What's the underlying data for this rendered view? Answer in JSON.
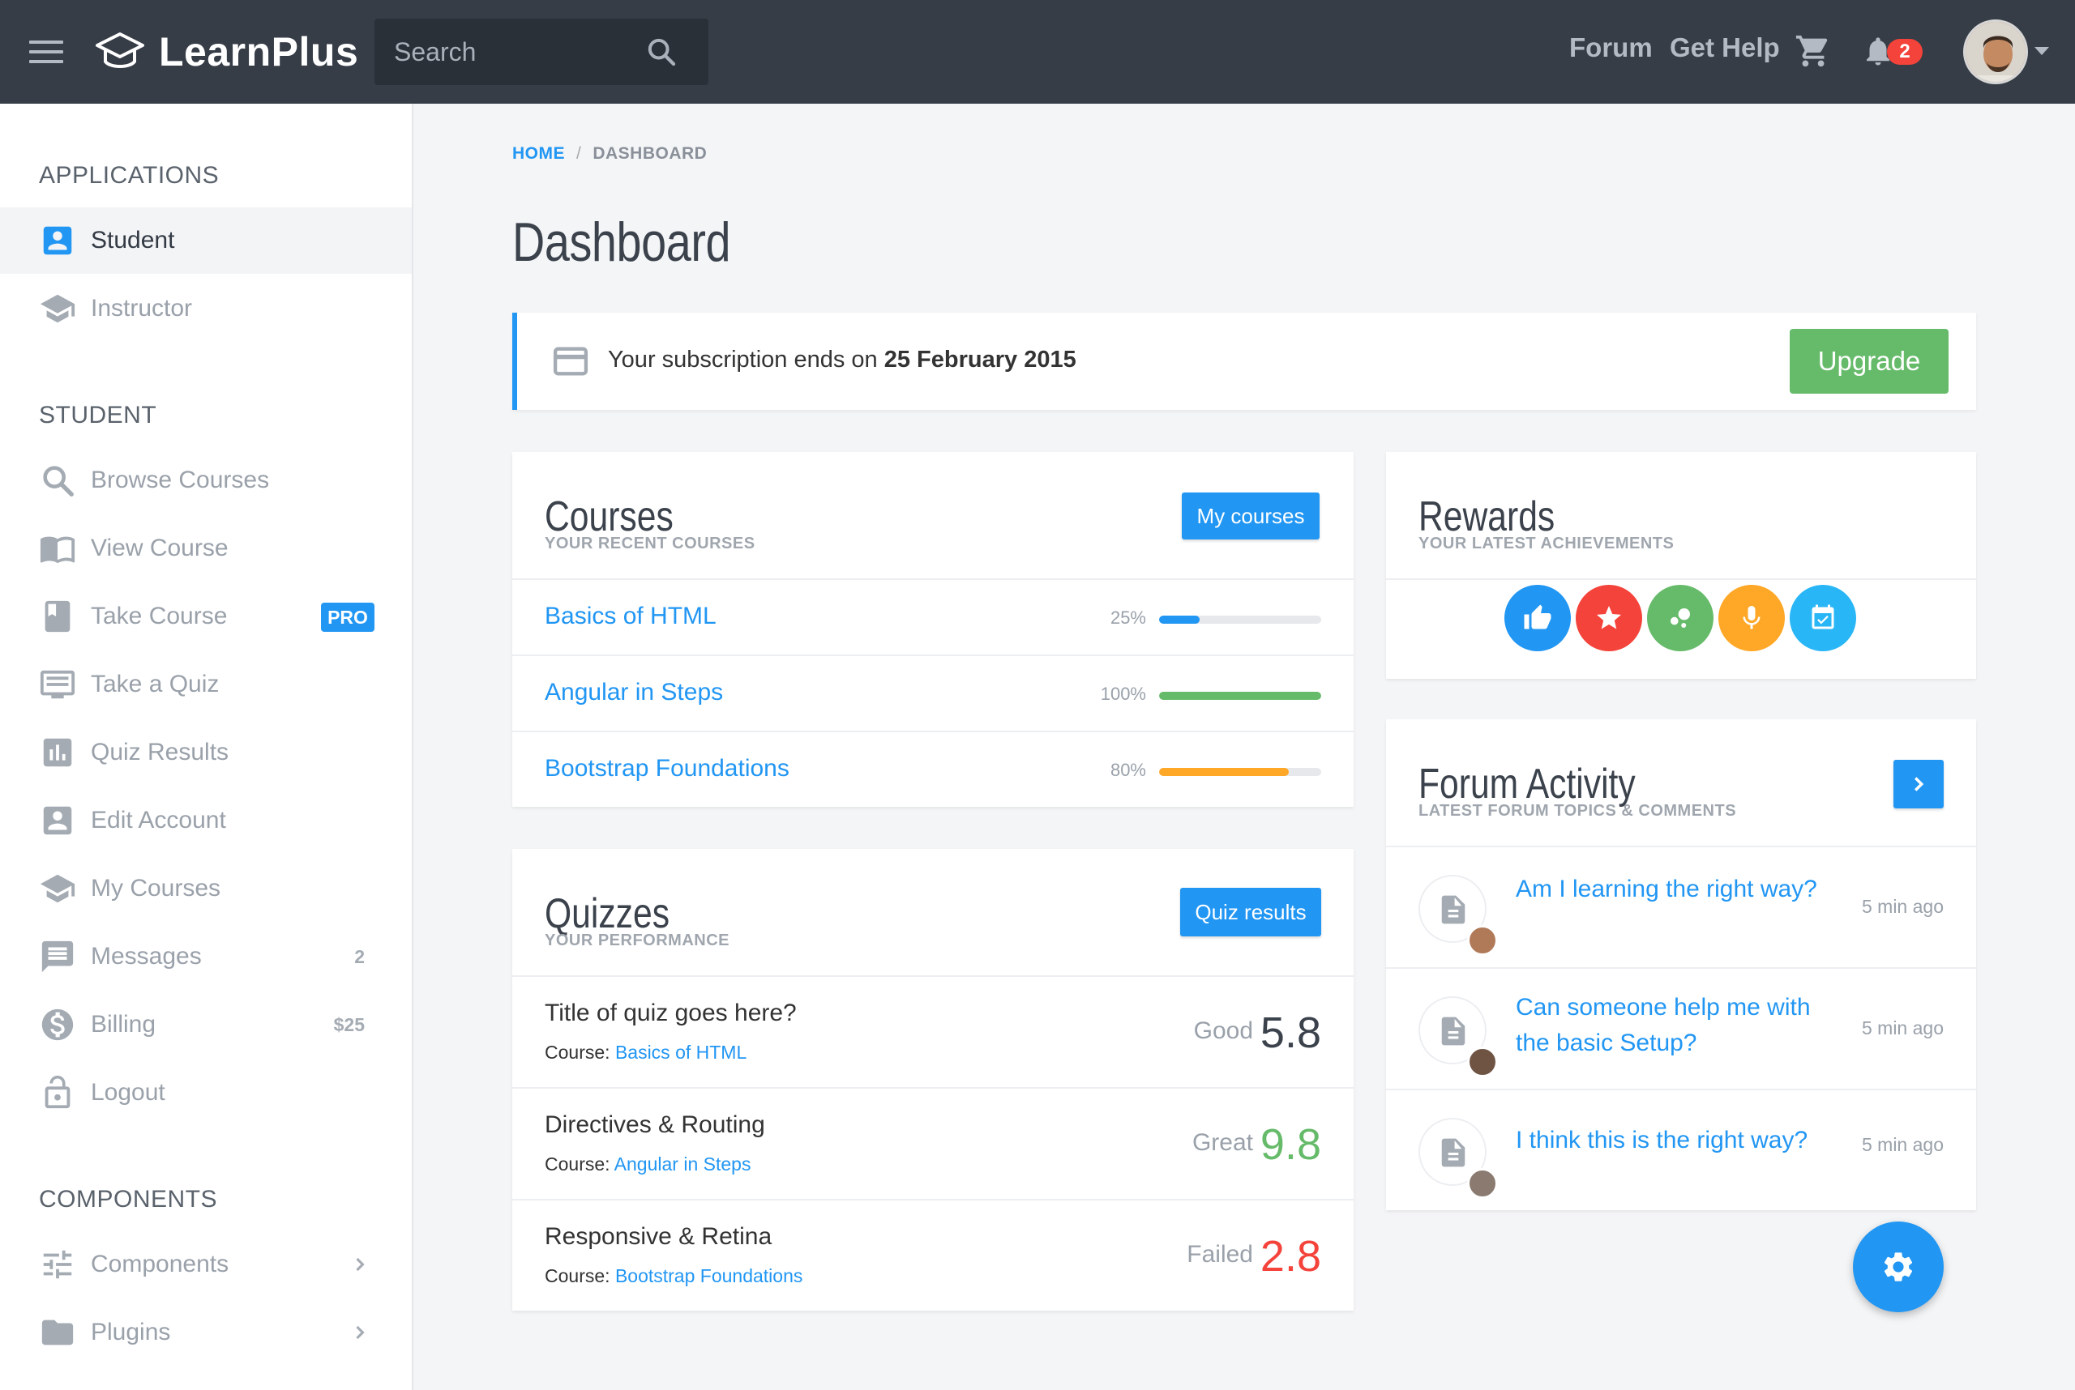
{
  "topbar": {
    "brand": "LearnPlus",
    "search_placeholder": "Search",
    "links": [
      "Forum",
      "Get Help"
    ],
    "notification_count": "2"
  },
  "sidebar": {
    "applications_heading": "APPLICATIONS",
    "applications": [
      {
        "label": "Student",
        "icon": "account-box-icon",
        "active": true
      },
      {
        "label": "Instructor",
        "icon": "school-icon",
        "active": false
      }
    ],
    "student_heading": "STUDENT",
    "student_items": [
      {
        "label": "Browse Courses",
        "icon": "search-icon"
      },
      {
        "label": "View Course",
        "icon": "book-open-icon"
      },
      {
        "label": "Take Course",
        "icon": "bookmark-book-icon",
        "badge": "PRO"
      },
      {
        "label": "Take a Quiz",
        "icon": "quiz-screen-icon"
      },
      {
        "label": "Quiz Results",
        "icon": "bar-chart-icon"
      },
      {
        "label": "Edit Account",
        "icon": "account-box-icon"
      },
      {
        "label": "My Courses",
        "icon": "school-icon"
      },
      {
        "label": "Messages",
        "icon": "message-icon",
        "count": "2"
      },
      {
        "label": "Billing",
        "icon": "dollar-icon",
        "count": "$25"
      },
      {
        "label": "Logout",
        "icon": "lock-icon"
      }
    ],
    "components_heading": "COMPONENTS",
    "component_items": [
      {
        "label": "Components",
        "icon": "tune-icon"
      },
      {
        "label": "Plugins",
        "icon": "folder-icon"
      }
    ]
  },
  "breadcrumb": {
    "home": "HOME",
    "current": "DASHBOARD"
  },
  "page_title": "Dashboard",
  "subscription": {
    "text": "Your subscription ends on",
    "date": "25 February 2015",
    "button": "Upgrade"
  },
  "courses": {
    "title": "Courses",
    "subtitle": "YOUR RECENT COURSES",
    "button": "My courses",
    "items": [
      {
        "name": "Basics of HTML",
        "percent_label": "25%",
        "progress": 0.25,
        "color": "#2196f3"
      },
      {
        "name": "Angular in Steps",
        "percent_label": "100%",
        "progress": 1.0,
        "color": "#66bb6a"
      },
      {
        "name": "Bootstrap Foundations",
        "percent_label": "80%",
        "progress": 0.8,
        "color": "#ffa726"
      }
    ]
  },
  "quizzes": {
    "title": "Quizzes",
    "subtitle": "YOUR PERFORMANCE",
    "button": "Quiz results",
    "course_prefix": "Course:",
    "items": [
      {
        "title": "Title of quiz goes here?",
        "course": "Basics of HTML",
        "rating": "Good",
        "score": "5.8",
        "score_color": "#3b424c"
      },
      {
        "title": "Directives & Routing",
        "course": "Angular in Steps",
        "rating": "Great",
        "score": "9.8",
        "score_color": "#66bb6a"
      },
      {
        "title": "Responsive & Retina",
        "course": "Bootstrap Foundations",
        "rating": "Failed",
        "score": "2.8",
        "score_color": "#f4433a"
      }
    ]
  },
  "rewards": {
    "title": "Rewards",
    "subtitle": "YOUR LATEST ACHIEVEMENTS",
    "badges": [
      {
        "icon": "thumb-up-icon",
        "color": "#2196f3"
      },
      {
        "icon": "star-icon",
        "color": "#f4433a"
      },
      {
        "icon": "bubbles-icon",
        "color": "#66bb6a"
      },
      {
        "icon": "mic-icon",
        "color": "#ffa726"
      },
      {
        "icon": "calendar-check-icon",
        "color": "#29b6f6"
      }
    ]
  },
  "forum": {
    "title": "Forum Activity",
    "subtitle": "LATEST FORUM TOPICS & COMMENTS",
    "items": [
      {
        "topic": "Am I learning the right way?",
        "time": "5 min ago"
      },
      {
        "topic": "Can someone help me with the basic Setup?",
        "time": "5 min ago"
      },
      {
        "topic": "I think this is the right way?",
        "time": "5 min ago"
      }
    ]
  },
  "colors": {
    "topbar": "#363d47",
    "accent": "#2196f3",
    "success": "#66bb6a",
    "warning": "#ffa726",
    "danger": "#f4433a"
  }
}
